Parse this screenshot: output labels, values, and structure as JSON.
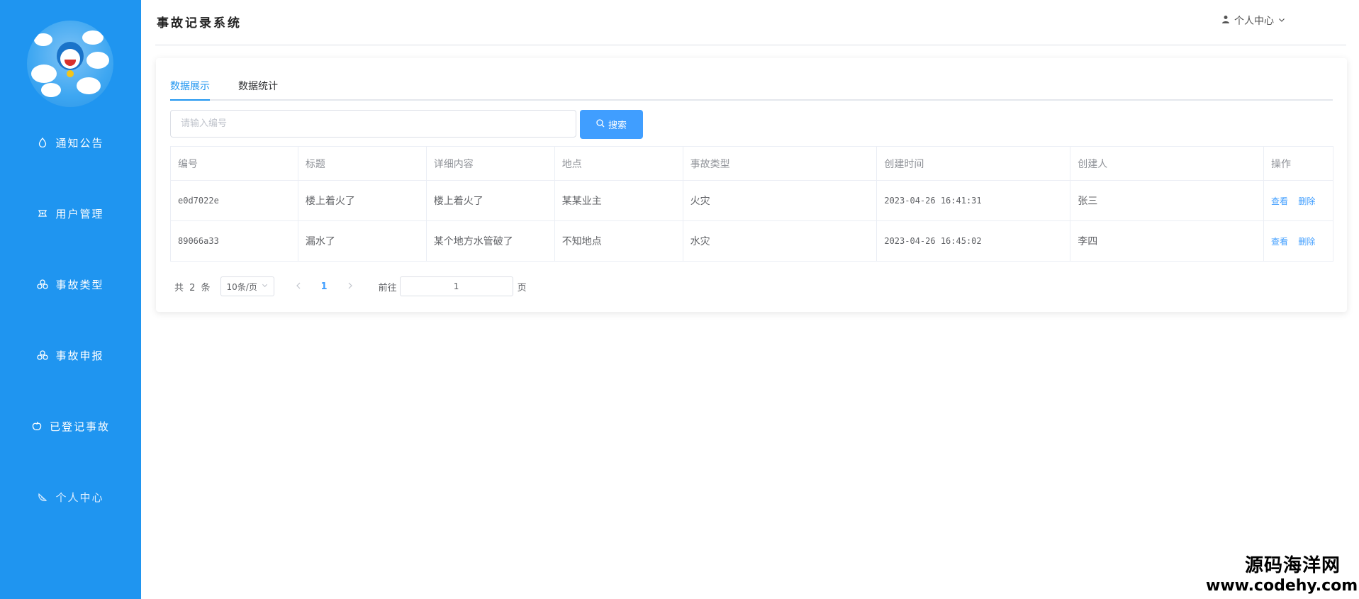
{
  "app": {
    "title": "事故记录系统",
    "user_menu_label": "个人中心"
  },
  "sidebar": {
    "items": [
      {
        "label": "通知公告",
        "icon": "drop-icon"
      },
      {
        "label": "用户管理",
        "icon": "ticket-icon"
      },
      {
        "label": "事故类型",
        "icon": "cherries-icon"
      },
      {
        "label": "事故申报",
        "icon": "cherries-icon"
      },
      {
        "label": "已登记事故",
        "icon": "apple-icon"
      },
      {
        "label": "个人中心",
        "icon": "watermelon-icon"
      }
    ]
  },
  "tabs": [
    {
      "label": "数据展示",
      "active": true
    },
    {
      "label": "数据统计",
      "active": false
    }
  ],
  "search": {
    "placeholder": "请输入编号",
    "value": "",
    "button_label": "搜索"
  },
  "table": {
    "columns": [
      "编号",
      "标题",
      "详细内容",
      "地点",
      "事故类型",
      "创建时间",
      "创建人",
      "操作"
    ],
    "rows": [
      {
        "id": "e0d7022e",
        "title": "楼上着火了",
        "detail": "楼上着火了",
        "location": "某某业主",
        "type": "火灾",
        "created_at": "2023-04-26 16:41:31",
        "creator": "张三"
      },
      {
        "id": "89066a33",
        "title": "漏水了",
        "detail": "某个地方水管破了",
        "location": "不知地点",
        "type": "水灾",
        "created_at": "2023-04-26 16:45:02",
        "creator": "李四"
      }
    ],
    "actions": {
      "view": "查看",
      "delete": "删除"
    }
  },
  "pagination": {
    "total_text": "共 2 条",
    "page_size": "10条/页",
    "current_page": "1",
    "goto_label": "前往",
    "goto_value": "1",
    "goto_suffix": "页"
  },
  "watermark": {
    "line1": "源码海洋网",
    "line2": "www.codehy.com"
  },
  "colors": {
    "sidebar": "#1f95f0",
    "accent": "#409eff"
  }
}
